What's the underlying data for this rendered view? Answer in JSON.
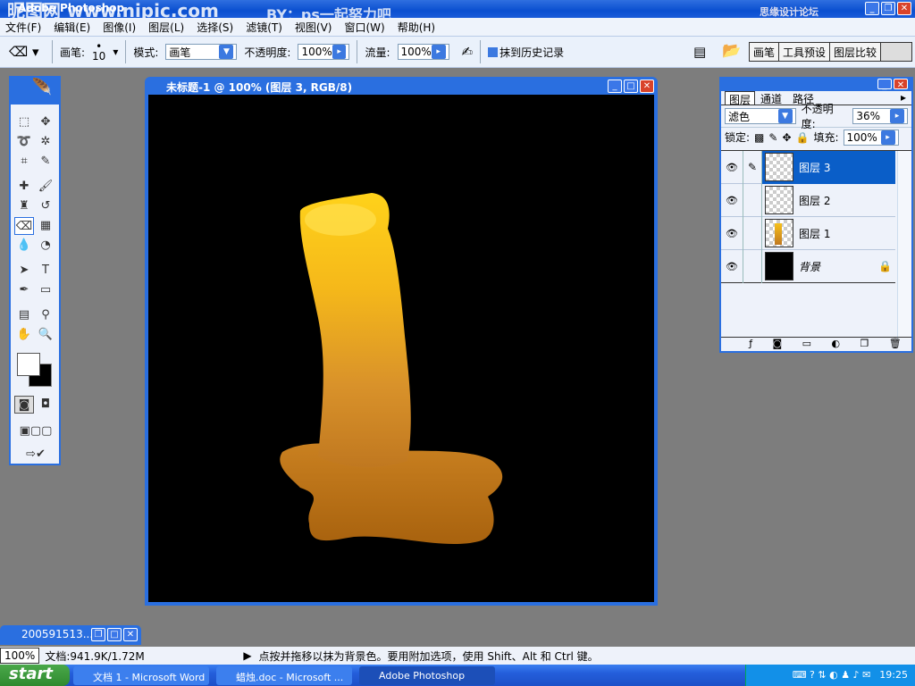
{
  "app": {
    "title": "Adobe Photoshop",
    "watermark": "昵图网 www.nipic.com",
    "by": "BY：ps一起努力吧",
    "site": "思缘设计论坛 WWW.MISSYUAN.COM"
  },
  "menu": [
    "文件(F)",
    "编辑(E)",
    "图像(I)",
    "图层(L)",
    "选择(S)",
    "滤镜(T)",
    "视图(V)",
    "窗口(W)",
    "帮助(H)"
  ],
  "options": {
    "brush_label": "画笔:",
    "brush_size": "10",
    "mode_label": "模式:",
    "mode_value": "画笔",
    "opacity_label": "不透明度:",
    "opacity_value": "100%",
    "flow_label": "流量:",
    "flow_value": "100%",
    "erase_history": "抹到历史记录",
    "palette_tabs": [
      "画笔",
      "工具预设",
      "图层比较"
    ]
  },
  "document": {
    "title": "未标题-1 @ 100% (图层 3, RGB/8)"
  },
  "layers_panel": {
    "tabs": [
      "图层",
      "通道",
      "路径"
    ],
    "blend_mode": "滤色",
    "opacity_label": "不透明度:",
    "opacity": "36%",
    "lock_label": "锁定:",
    "fill_label": "填充:",
    "fill": "100%",
    "layers": [
      {
        "name": "图层 3",
        "selected": true
      },
      {
        "name": "图层 2"
      },
      {
        "name": "图层 1"
      },
      {
        "name": "背景",
        "locked": true
      }
    ]
  },
  "minimized": {
    "title": "200591513..."
  },
  "status": {
    "zoom": "100%",
    "doc": "文档:941.9K/1.72M",
    "hint": "点按并拖移以抹为背景色。要用附加选项，使用 Shift、Alt 和 Ctrl 键。"
  },
  "taskbar": {
    "start": "start",
    "tasks": [
      "文档 1 - Microsoft Word",
      "蜡烛.doc - Microsoft ...",
      "Adobe Photoshop"
    ],
    "clock": "19:25"
  },
  "colors": {
    "xp_blue": "#2a6fe0",
    "selected_layer": "#0a5ec8"
  }
}
